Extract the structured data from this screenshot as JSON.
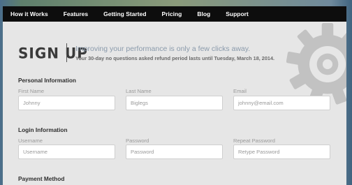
{
  "nav": {
    "items": [
      "How it Works",
      "Features",
      "Getting Started",
      "Pricing",
      "Blog",
      "Support"
    ]
  },
  "header": {
    "title": "SIGN UP",
    "tagline": "Improving your performance is only a few clicks away.",
    "subline": "Your 30-day no questions asked refund period lasts until Tuesday, March 18, 2014."
  },
  "personal": {
    "title": "Personal Information",
    "first_name_label": "First Name",
    "first_name_placeholder": "Johnny",
    "last_name_label": "Last Name",
    "last_name_placeholder": "Biglegs",
    "email_label": "Email",
    "email_placeholder": "johnny@email.com"
  },
  "login": {
    "title": "Login Information",
    "username_label": "Username",
    "username_placeholder": "Username",
    "password_label": "Password",
    "password_placeholder": "Password",
    "repeat_label": "Repeat Password",
    "repeat_placeholder": "Retype Password"
  },
  "payment": {
    "title": "Payment Method"
  },
  "colors": {
    "nav_bg": "#0d0d0d",
    "panel_bg": "#e6e6e6",
    "tagline": "#8a9aab",
    "gear": "#bcbcbc"
  },
  "icons": [
    "gear-icon"
  ]
}
